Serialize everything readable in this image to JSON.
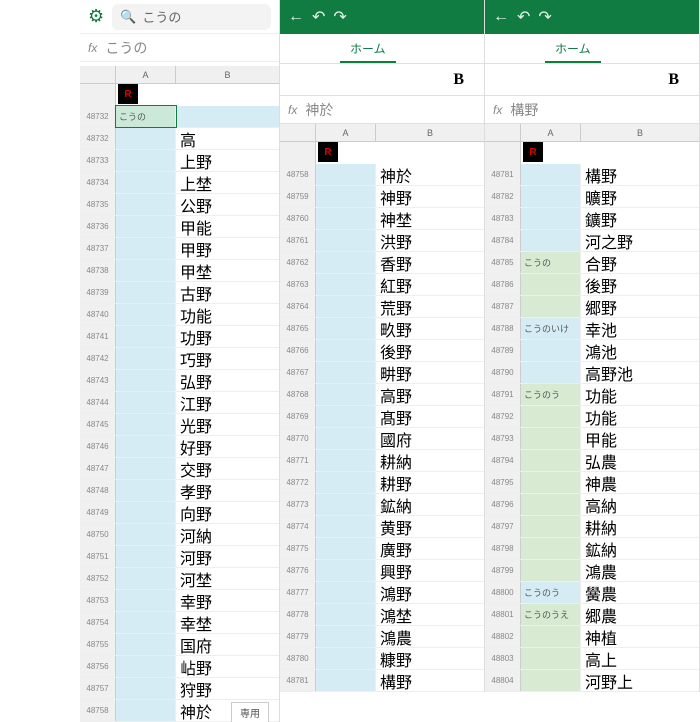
{
  "panel1": {
    "search_placeholder": "こうの",
    "fx_value": "こうの",
    "colA": "A",
    "colB": "B",
    "sel_row": "48732",
    "sel_A": "こうの",
    "rows": [
      {
        "n": "48732",
        "b": "高"
      },
      {
        "n": "48733",
        "b": "上野"
      },
      {
        "n": "48734",
        "b": "上埜"
      },
      {
        "n": "48735",
        "b": "公野"
      },
      {
        "n": "48736",
        "b": "甲能"
      },
      {
        "n": "48737",
        "b": "甲野"
      },
      {
        "n": "48738",
        "b": "甲埜"
      },
      {
        "n": "48739",
        "b": "古野"
      },
      {
        "n": "48740",
        "b": "功能"
      },
      {
        "n": "48741",
        "b": "功野"
      },
      {
        "n": "48742",
        "b": "巧野"
      },
      {
        "n": "48743",
        "b": "弘野"
      },
      {
        "n": "48744",
        "b": "江野"
      },
      {
        "n": "48745",
        "b": "光野"
      },
      {
        "n": "48746",
        "b": "好野"
      },
      {
        "n": "48747",
        "b": "交野"
      },
      {
        "n": "48748",
        "b": "孝野"
      },
      {
        "n": "48749",
        "b": "向野"
      },
      {
        "n": "48750",
        "b": "河納"
      },
      {
        "n": "48751",
        "b": "河野"
      },
      {
        "n": "48752",
        "b": "河埜"
      },
      {
        "n": "48753",
        "b": "幸野"
      },
      {
        "n": "48754",
        "b": "幸埜"
      },
      {
        "n": "48755",
        "b": "国府"
      },
      {
        "n": "48756",
        "b": "岾野"
      },
      {
        "n": "48757",
        "b": "狩野"
      },
      {
        "n": "48758",
        "b": "神於"
      }
    ],
    "sheet_tab": "専用"
  },
  "panel2": {
    "tab_home": "ホーム",
    "bold": "B",
    "fx_value": "神於",
    "colA": "A",
    "colB": "B",
    "rows": [
      {
        "n": "48758",
        "b": "神於"
      },
      {
        "n": "48759",
        "b": "神野"
      },
      {
        "n": "48760",
        "b": "神埜"
      },
      {
        "n": "48761",
        "b": "洪野"
      },
      {
        "n": "48762",
        "b": "香野"
      },
      {
        "n": "48763",
        "b": "紅野"
      },
      {
        "n": "48764",
        "b": "荒野"
      },
      {
        "n": "48765",
        "b": "畂野"
      },
      {
        "n": "48766",
        "b": "後野"
      },
      {
        "n": "48767",
        "b": "畊野"
      },
      {
        "n": "48768",
        "b": "高野"
      },
      {
        "n": "48769",
        "b": "髙野"
      },
      {
        "n": "48770",
        "b": "國府"
      },
      {
        "n": "48771",
        "b": "耕納"
      },
      {
        "n": "48772",
        "b": "耕野"
      },
      {
        "n": "48773",
        "b": "鉱納"
      },
      {
        "n": "48774",
        "b": "黄野"
      },
      {
        "n": "48775",
        "b": "廣野"
      },
      {
        "n": "48776",
        "b": "興野"
      },
      {
        "n": "48777",
        "b": "鴻野"
      },
      {
        "n": "48778",
        "b": "鴻埜"
      },
      {
        "n": "48779",
        "b": "鴻農"
      },
      {
        "n": "48780",
        "b": "糠野"
      },
      {
        "n": "48781",
        "b": "構野"
      }
    ]
  },
  "panel3": {
    "tab_home": "ホーム",
    "bold": "B",
    "fx_value": "構野",
    "colA": "A",
    "colB": "B",
    "rows": [
      {
        "n": "48781",
        "a": "",
        "b": "構野",
        "hl": "blue"
      },
      {
        "n": "48782",
        "a": "",
        "b": "曠野",
        "hl": "blue"
      },
      {
        "n": "48783",
        "a": "",
        "b": "鑛野",
        "hl": "blue"
      },
      {
        "n": "48784",
        "a": "",
        "b": "河之野",
        "hl": "blue"
      },
      {
        "n": "48785",
        "a": "こうの",
        "b": "合野",
        "hl": "green"
      },
      {
        "n": "48786",
        "a": "",
        "b": "後野",
        "hl": "green"
      },
      {
        "n": "48787",
        "a": "",
        "b": "郷野",
        "hl": "green"
      },
      {
        "n": "48788",
        "a": "こうのいけ",
        "b": "幸池",
        "hl": "blue"
      },
      {
        "n": "48789",
        "a": "",
        "b": "鴻池",
        "hl": "blue"
      },
      {
        "n": "48790",
        "a": "",
        "b": "高野池",
        "hl": "blue"
      },
      {
        "n": "48791",
        "a": "こうのう",
        "b": "功能",
        "hl": "green"
      },
      {
        "n": "48792",
        "a": "",
        "b": "功能",
        "hl": "green"
      },
      {
        "n": "48793",
        "a": "",
        "b": "甲能",
        "hl": "green"
      },
      {
        "n": "48794",
        "a": "",
        "b": "弘農",
        "hl": "green"
      },
      {
        "n": "48795",
        "a": "",
        "b": "神農",
        "hl": "green"
      },
      {
        "n": "48796",
        "a": "",
        "b": "高納",
        "hl": "green"
      },
      {
        "n": "48797",
        "a": "",
        "b": "耕納",
        "hl": "green"
      },
      {
        "n": "48798",
        "a": "",
        "b": "鉱納",
        "hl": "green"
      },
      {
        "n": "48799",
        "a": "",
        "b": "鴻農",
        "hl": "green"
      },
      {
        "n": "48800",
        "a": "こうのう",
        "b": "黌農",
        "hl": "blue"
      },
      {
        "n": "48801",
        "a": "こうのうえ",
        "b": "郷農",
        "hl": "green"
      },
      {
        "n": "48802",
        "a": "",
        "b": "神植",
        "hl": "green"
      },
      {
        "n": "48803",
        "a": "",
        "b": "高上",
        "hl": "green"
      },
      {
        "n": "48804",
        "a": "",
        "b": "河野上",
        "hl": "green"
      }
    ]
  }
}
